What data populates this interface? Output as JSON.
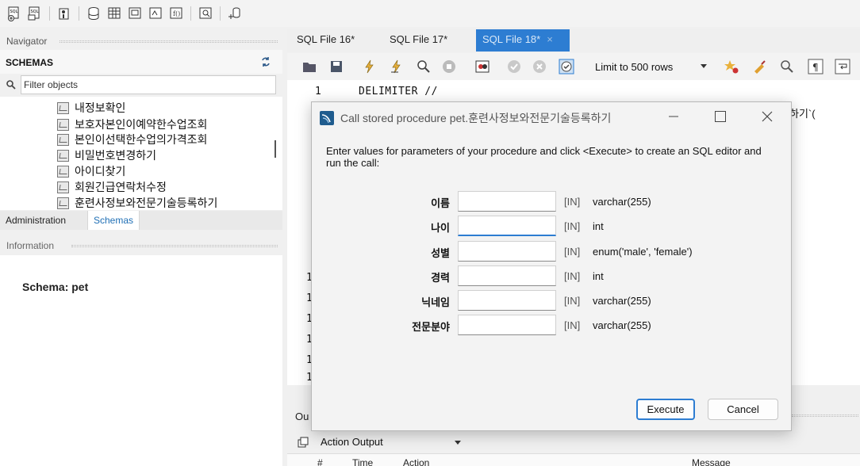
{
  "navigator": {
    "header": "Navigator",
    "schemas_title": "SCHEMAS",
    "filter_placeholder": "Filter objects",
    "tree_items": [
      "내정보확인",
      "보호자본인이예약한수업조회",
      "본인이선택한수업의가격조회",
      "비밀번호변경하기",
      "아이디찾기",
      "회원긴급연락처수정",
      "훈련사정보와전문기술등록하기"
    ],
    "tabs": [
      "Administration",
      "Schemas"
    ],
    "info_header": "Information",
    "schema_label": "Schema: pet"
  },
  "editor": {
    "tabs": [
      "SQL File 16*",
      "SQL File 17*",
      "SQL File 18*"
    ],
    "tab_close": "×",
    "limit_label": "Limit to 500 rows",
    "line1_number": "1",
    "line1_code": "DELIMITER //",
    "code_fragment": "하기`(",
    "gutter_numbers": [
      "1",
      "1",
      "1",
      "1",
      "1",
      "1"
    ]
  },
  "output": {
    "header": "Ou",
    "selector": "Action Output",
    "columns": [
      "#",
      "Time",
      "Action",
      "Message"
    ]
  },
  "dialog": {
    "title": "Call stored procedure pet.훈련사정보와전문기술등록하기",
    "instructions": "Enter values for parameters of your procedure and click <Execute> to create an SQL editor and run the call:",
    "params": [
      {
        "name": "이름",
        "dir": "[IN]",
        "type": "varchar(255)",
        "value": ""
      },
      {
        "name": "나이",
        "dir": "[IN]",
        "type": "int",
        "value": ""
      },
      {
        "name": "성별",
        "dir": "[IN]",
        "type": "enum('male', 'female')",
        "value": ""
      },
      {
        "name": "경력",
        "dir": "[IN]",
        "type": "int",
        "value": ""
      },
      {
        "name": "닉네임",
        "dir": "[IN]",
        "type": "varchar(255)",
        "value": ""
      },
      {
        "name": "전문분야",
        "dir": "[IN]",
        "type": "varchar(255)",
        "value": ""
      }
    ],
    "execute_label": "Execute",
    "cancel_label": "Cancel"
  },
  "colors": {
    "accent": "#2d7dd2",
    "tab_active": "#2d7dd2",
    "schemas_tab_text": "#1f6fb5"
  }
}
